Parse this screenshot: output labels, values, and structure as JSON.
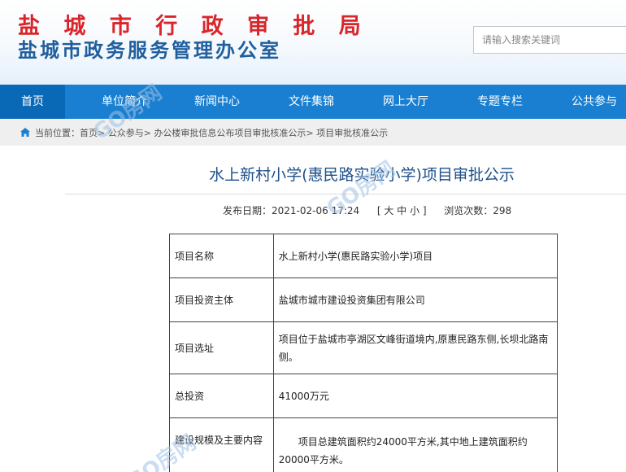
{
  "header": {
    "title_main": "盐 城 市 行 政 审 批 局",
    "title_sub": "盐城市政务服务管理办公室",
    "search_placeholder": "请输入搜索关键词"
  },
  "nav": {
    "items": [
      {
        "label": "首页"
      },
      {
        "label": "单位简介"
      },
      {
        "label": "新闻中心"
      },
      {
        "label": "文件集锦"
      },
      {
        "label": "网上大厅"
      },
      {
        "label": "专题专栏"
      },
      {
        "label": "公共参与"
      }
    ]
  },
  "breadcrumb": {
    "prefix": "当前位置：",
    "items": [
      "首页",
      "公众参与",
      "办公楼审批信息公布项目审批核准公示",
      "项目审批核准公示"
    ],
    "separator": ">"
  },
  "article": {
    "title": "水上新村小学(惠民路实验小学)项目审批公示",
    "date_label": "发布日期：",
    "date": "2021-02-06 17:24",
    "size_open": "[",
    "size_large": "大",
    "size_medium": "中",
    "size_small": "小",
    "size_close": "]",
    "views_label": "浏览次数：",
    "views": "298"
  },
  "table": {
    "rows": [
      {
        "label": "项目名称",
        "value": "水上新村小学(惠民路实验小学)项目"
      },
      {
        "label": "项目投资主体",
        "value": "盐城市城市建设投资集团有限公司"
      },
      {
        "label": "项目选址",
        "value": "项目位于盐城市亭湖区文峰街道境内,原惠民路东侧,长坝北路南侧。"
      },
      {
        "label": "总投资",
        "value": "41000万元"
      },
      {
        "label": "建设规模及主要内容",
        "value": "项目总建筑面积约24000平方米,其中地上建筑面积约20000平方米。"
      }
    ]
  },
  "watermark": {
    "text": "GO房网"
  },
  "colors": {
    "title_red": "#d9262b",
    "title_blue": "#1f5f9e",
    "nav_blue": "#1a7fd0",
    "nav_active": "#0a69b7"
  }
}
